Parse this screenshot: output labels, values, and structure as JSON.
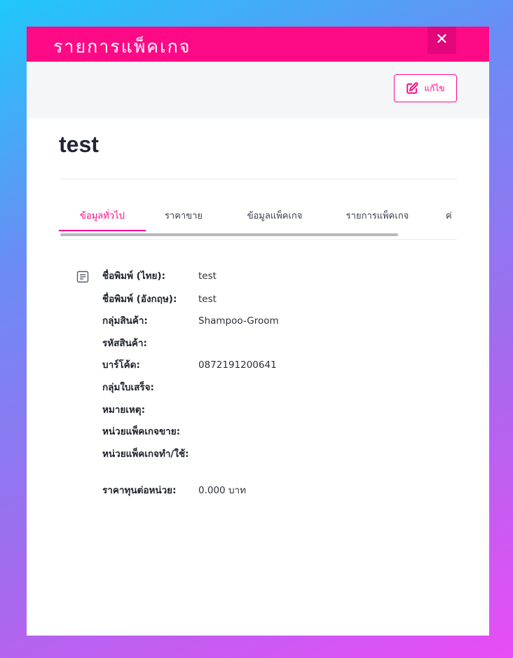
{
  "modal": {
    "title": "รายการแพ็คเกจ",
    "close_symbol": "✕",
    "edit_label": "แก้ไข",
    "record_title": "test",
    "accent_color": "#ff0a86"
  },
  "tabs": [
    {
      "label": "ข้อมูลทั่วไป",
      "active": true
    },
    {
      "label": "ราคาขาย",
      "active": false
    },
    {
      "label": "ข้อมูลแพ็คเกจ",
      "active": false
    },
    {
      "label": "รายการแพ็คเกจ",
      "active": false
    },
    {
      "label": "ค่",
      "active": false
    }
  ],
  "details": [
    {
      "label": "ชื่อพิมพ์ (ไทย):",
      "value": "test"
    },
    {
      "label": "ชื่อพิมพ์ (อังกฤษ):",
      "value": "test"
    },
    {
      "label": "กลุ่มสินค้า:",
      "value": "Shampoo-Groom"
    },
    {
      "label": "รหัสสินค้า:",
      "value": ""
    },
    {
      "label": "บาร์โค้ด:",
      "value": "0872191200641"
    },
    {
      "label": "กลุ่มใบเสร็จ:",
      "value": ""
    },
    {
      "label": "หมายเหตุ:",
      "value": ""
    },
    {
      "label": "หน่วยแพ็คเกจขาย:",
      "value": ""
    },
    {
      "label": "หน่วยแพ็คเกจทำ/ใช้:",
      "value": ""
    },
    {
      "label": "ราคาทุนต่อหน่วย:",
      "value": "0.000 บาท"
    }
  ],
  "icons": {
    "close": "close-icon",
    "edit": "edit-icon",
    "details": "document-icon"
  }
}
